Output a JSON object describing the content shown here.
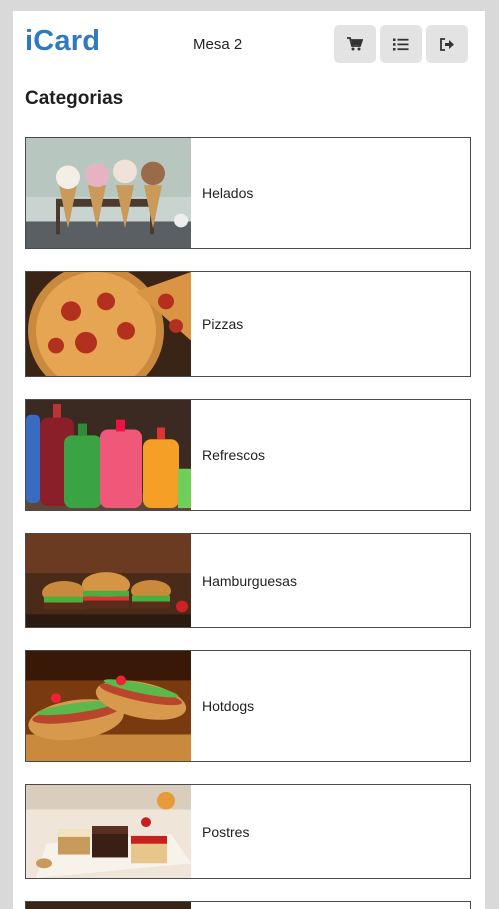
{
  "app": {
    "brand": "iCard",
    "table_label": "Mesa 2"
  },
  "header_buttons": [
    {
      "icon": "cart-icon"
    },
    {
      "icon": "list-icon"
    },
    {
      "icon": "logout-icon"
    }
  ],
  "section_title": "Categorias",
  "categories": [
    {
      "label": "Helados",
      "image": "ice-cream-cones"
    },
    {
      "label": "Pizzas",
      "image": "pizza"
    },
    {
      "label": "Refrescos",
      "image": "soda-bottles"
    },
    {
      "label": "Hamburguesas",
      "image": "burgers"
    },
    {
      "label": "Hotdogs",
      "image": "hotdogs"
    },
    {
      "label": "Postres",
      "image": "desserts"
    }
  ],
  "colors": {
    "brand": "#2f7abf",
    "button_bg": "#e3e3e3",
    "card_border": "#4a4a4a",
    "page_bg": "#d9d9d9"
  }
}
